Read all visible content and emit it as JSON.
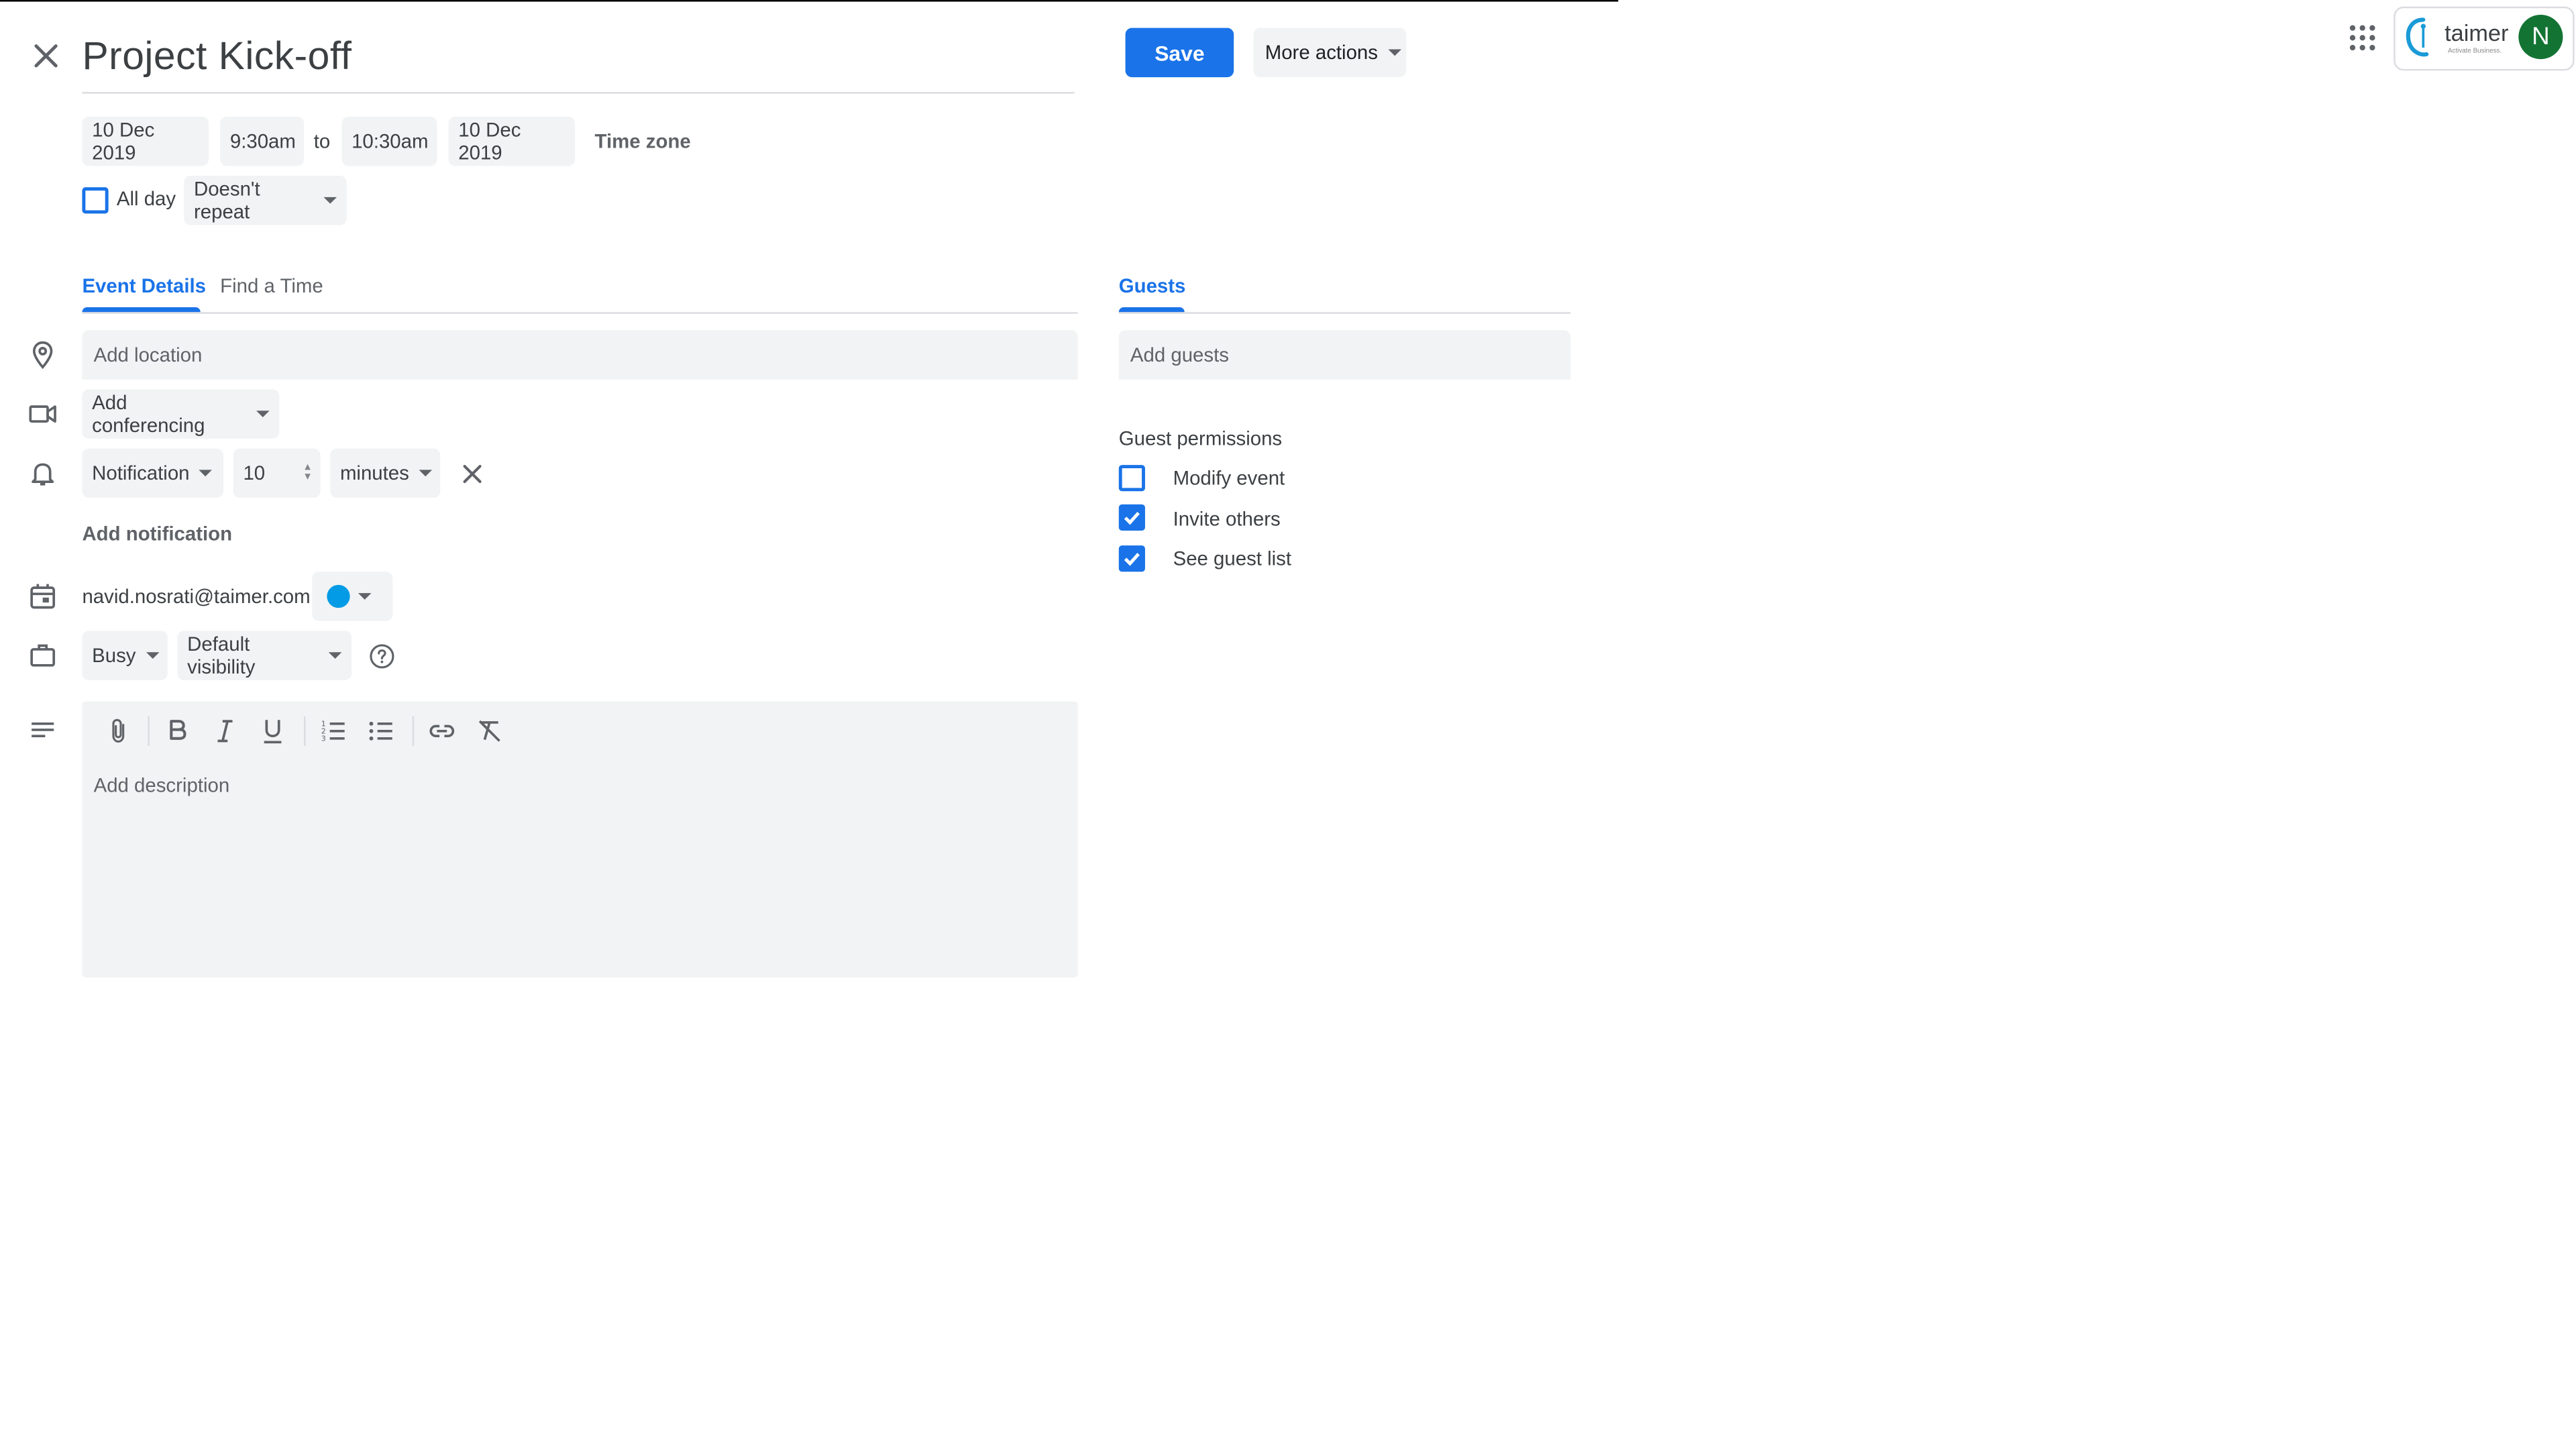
{
  "header": {
    "title": "Project Kick-off",
    "save_label": "Save",
    "more_actions_label": "More actions"
  },
  "datetime": {
    "start_date": "10 Dec 2019",
    "start_time": "9:30am",
    "to_label": "to",
    "end_time": "10:30am",
    "end_date": "10 Dec 2019",
    "time_zone_label": "Time zone",
    "all_day_label": "All day",
    "all_day_checked": false,
    "repeat_label": "Doesn't repeat"
  },
  "tabs": {
    "event_details": "Event Details",
    "find_a_time": "Find a Time",
    "guests": "Guests"
  },
  "details": {
    "location_placeholder": "Add location",
    "conferencing_label": "Add conferencing",
    "notification_type": "Notification",
    "notification_value": "10",
    "notification_unit": "minutes",
    "add_notification_label": "Add notification",
    "calendar_owner": "navid.nosrati@taimer.com",
    "calendar_color": "#039be5",
    "availability": "Busy",
    "visibility": "Default visibility",
    "description_placeholder": "Add description",
    "toolbar_icons": [
      "attach-icon",
      "bold-icon",
      "italic-icon",
      "underline-icon",
      "numbered-list-icon",
      "bulleted-list-icon",
      "link-icon",
      "remove-formatting-icon"
    ]
  },
  "guests": {
    "add_guests_placeholder": "Add guests",
    "permissions_title": "Guest permissions",
    "permissions": [
      {
        "label": "Modify event",
        "checked": false
      },
      {
        "label": "Invite others",
        "checked": true
      },
      {
        "label": "See guest list",
        "checked": true
      }
    ]
  },
  "account": {
    "logo_text": "taimer",
    "logo_tagline": "Activate Business.",
    "avatar_initial": "N"
  },
  "colors": {
    "accent": "#1a73e8",
    "field_bg": "#f1f3f4",
    "avatar_bg": "#137333"
  }
}
